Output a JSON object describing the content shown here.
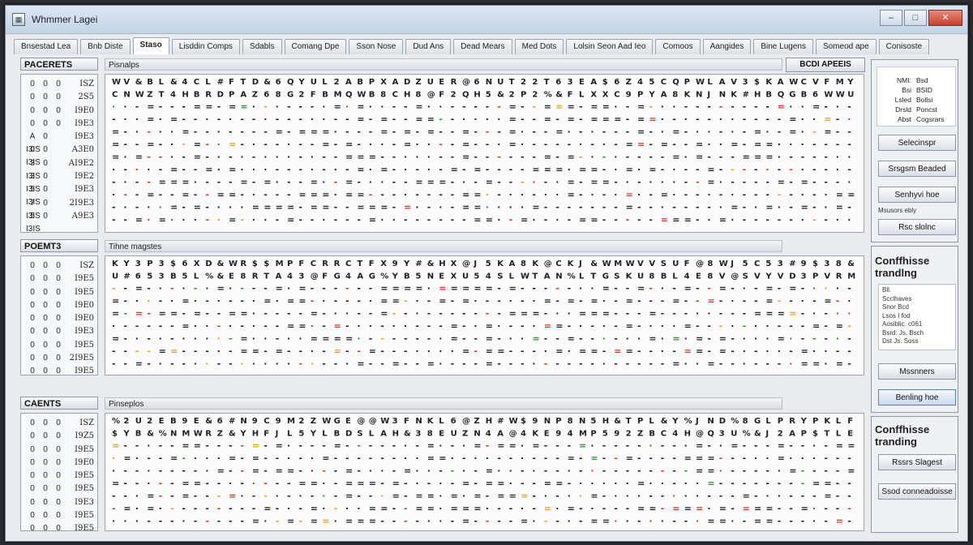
{
  "window": {
    "title": "Whmmer Lagei",
    "icon": "window-app-icon",
    "minimize": "–",
    "maximize": "□",
    "close": "✕"
  },
  "tabs": [
    "Bnsestad Lea",
    "Bnb Diste",
    "Staso",
    "Lisddin Comps",
    "Sdabls",
    "Comang Dpe",
    "Sson Nose",
    "Dud Ans",
    "Dead Mears",
    "Med Dots",
    "Lolsin Seon Aad Ieo",
    "Comoos",
    "Aangides",
    "Bine Lugens",
    "Someod ape",
    "Conisoste"
  ],
  "active_tab_index": 2,
  "sections": [
    {
      "label": "PACERETS",
      "sub": "Pisnalps",
      "right_button": "BCDI APEEIS",
      "rows": [
        [
          "0",
          "0",
          "0",
          "ISZ"
        ],
        [
          "0",
          "0",
          "0",
          "2S5"
        ],
        [
          "0",
          "0",
          "0",
          "I9E0"
        ],
        [
          "0",
          "0",
          "0",
          "I9E3"
        ],
        [
          "A I3IS",
          "0",
          "",
          "I9E3"
        ],
        [
          "0 I3IS",
          "0",
          "",
          "A3E0"
        ],
        [
          "3 I3IS",
          "0",
          "",
          "AI9E2"
        ],
        [
          "3 I3IS",
          "0",
          "",
          "I9E2"
        ],
        [
          "5 I3IS",
          "0",
          "",
          "I9E3"
        ],
        [
          "7 I3IS",
          "0",
          "",
          "2I9E3"
        ],
        [
          "5 I3IS",
          "0",
          "",
          "A9E3"
        ]
      ]
    },
    {
      "label": "POEMT3",
      "sub": "Tihne magstes",
      "right_button": "",
      "rows": [
        [
          "0",
          "0",
          "0",
          "ISZ"
        ],
        [
          "0",
          "0",
          "0",
          "I9E5"
        ],
        [
          "0",
          "0",
          "0",
          "I9E5"
        ],
        [
          "0",
          "0",
          "0",
          "I9E0"
        ],
        [
          "0",
          "0",
          "0",
          "I9E0"
        ],
        [
          "0",
          "0",
          "0",
          "I9E3"
        ],
        [
          "0",
          "0",
          "0",
          "I9E5"
        ],
        [
          "0",
          "0",
          "0",
          "2I9E5"
        ],
        [
          "0",
          "0",
          "0",
          "I9E5"
        ]
      ]
    },
    {
      "label": "CAENTS",
      "sub": "Pinseplos",
      "right_button": "",
      "rows": [
        [
          "0",
          "0",
          "0",
          "ISZ"
        ],
        [
          "0",
          "0",
          "0",
          "I9Z5"
        ],
        [
          "0",
          "0",
          "0",
          "I9E5"
        ],
        [
          "0",
          "0",
          "0",
          "I9E0"
        ],
        [
          "0",
          "0",
          "0",
          "I9E5"
        ],
        [
          "0",
          "0",
          "0",
          "I9E5"
        ],
        [
          "0",
          "0",
          "0",
          "I9E3"
        ],
        [
          "0",
          "0",
          "0",
          "I9E5"
        ],
        [
          "0",
          "0",
          "0",
          "I9E5"
        ]
      ]
    }
  ],
  "side": {
    "info": [
      [
        "NMI:",
        "Bsd"
      ],
      [
        "Bsi",
        "BSID"
      ],
      [
        "Lsled",
        "Bollsi"
      ],
      [
        "Drsld",
        "Poncst"
      ],
      [
        "Abst",
        "Cogsrars"
      ]
    ],
    "btn1": "Selecinspr",
    "btn2": "Srsgsm Beaded",
    "btn3": "Senhyvi hoe",
    "note": "Msusors ebly",
    "btn4": "Rsc slolnc",
    "title2": "Conffhisse trandlng",
    "list": [
      "Bll.",
      "Scclhaves",
      "Snor Bcd",
      "Lsos I fod",
      "Aosiblic. c061",
      "Bsrd: Js. Bsch",
      "Dst Js. Soss"
    ],
    "btn5": "Mssnners",
    "btn6": "Benling hoe",
    "title3": "Conffhisse tranding",
    "btn7": "Rssrs Slagest",
    "btn8": "Ssod conneadoisse"
  },
  "colors": {
    "accent_red": "#d8332a",
    "accent_green": "#2d8f2d",
    "accent_orange": "#e0a020",
    "glyph": "#1c1f24"
  }
}
